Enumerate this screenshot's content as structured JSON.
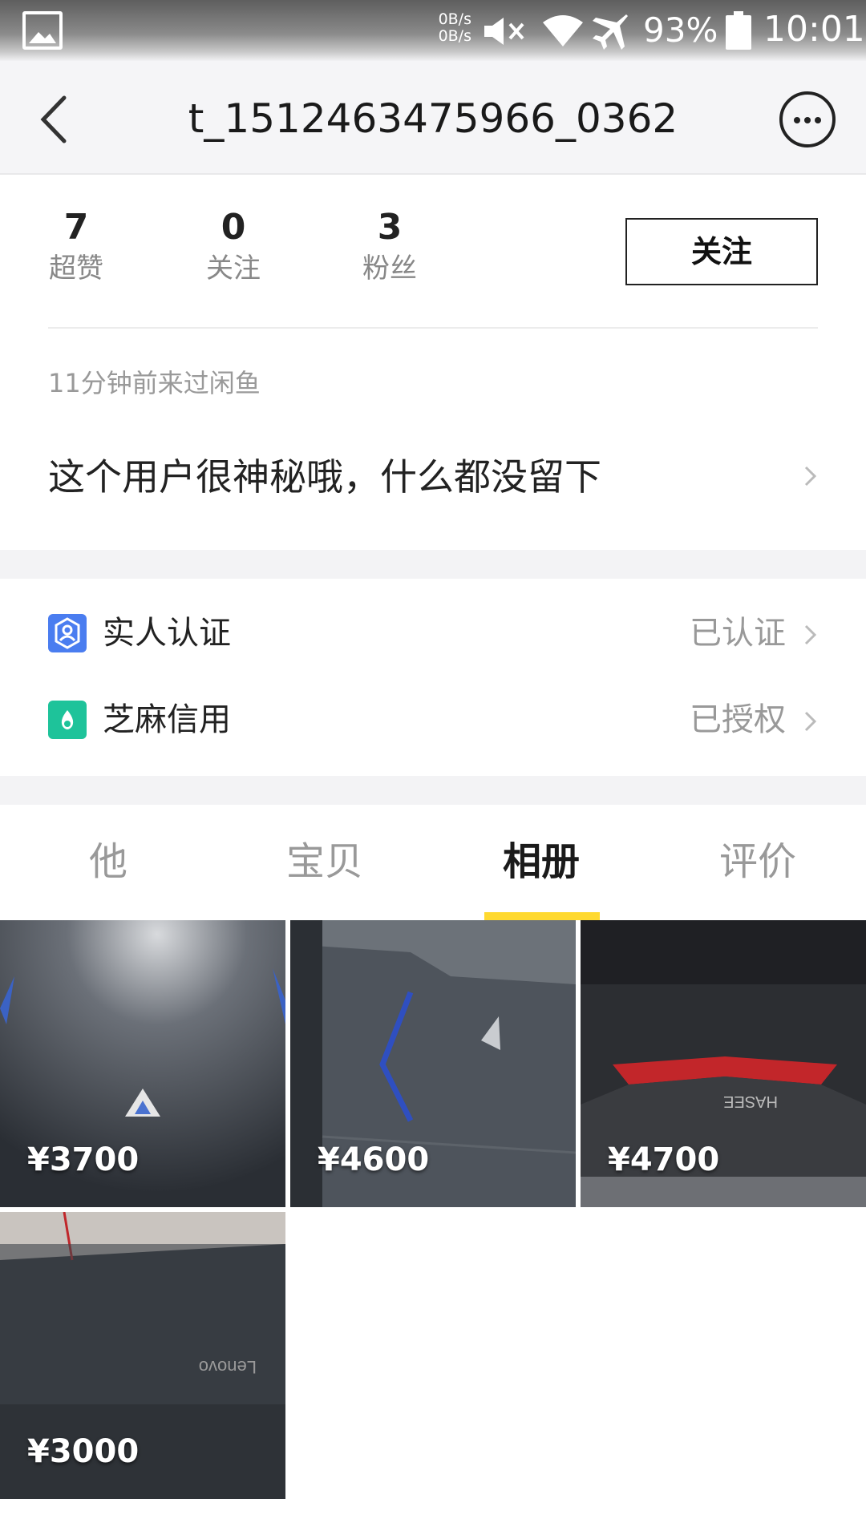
{
  "status_bar": {
    "speed_up": "0B/s",
    "speed_down": "0B/s",
    "battery": "93%",
    "time": "10:01"
  },
  "nav": {
    "title": "t_1512463475966_0362"
  },
  "stats": [
    {
      "value": "7",
      "label": "超赞"
    },
    {
      "value": "0",
      "label": "关注"
    },
    {
      "value": "3",
      "label": "粉丝"
    }
  ],
  "follow_label": "关注",
  "last_visit": "11分钟前来过闲鱼",
  "bio": "这个用户很神秘哦，什么都没留下",
  "verifications": [
    {
      "label": "实人认证",
      "status": "已认证",
      "icon": "person-badge-icon",
      "color": "#4a7df0"
    },
    {
      "label": "芝麻信用",
      "status": "已授权",
      "icon": "sesame-credit-icon",
      "color": "#1ec39a"
    }
  ],
  "tabs": [
    {
      "label": "他"
    },
    {
      "label": "宝贝"
    },
    {
      "label": "相册"
    },
    {
      "label": "评价"
    }
  ],
  "active_tab": "相册",
  "accent_color": "#ffd930",
  "album": [
    {
      "price": "¥3700"
    },
    {
      "price": "¥4600"
    },
    {
      "price": "¥4700"
    },
    {
      "price": "¥3000"
    }
  ]
}
